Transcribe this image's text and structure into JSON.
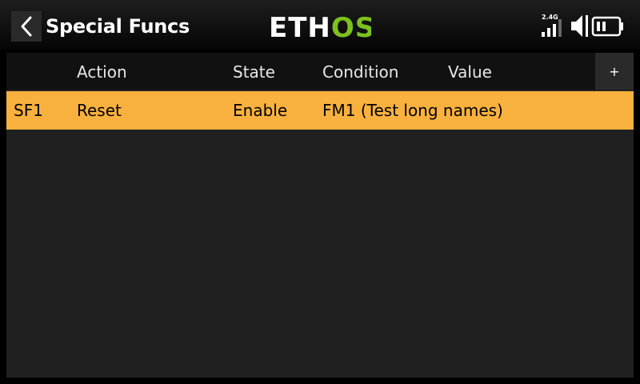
{
  "header": {
    "title": "Special Funcs",
    "logo_text": "ETHOS",
    "status": {
      "radio_band_label": "2.4G",
      "signal_level": 0.75,
      "icons": [
        "signal-bars-icon",
        "speaker-icon",
        "battery-icon"
      ]
    }
  },
  "table": {
    "columns": [
      "Action",
      "State",
      "Condition",
      "Value"
    ],
    "add_label": "+",
    "rows": [
      {
        "id": "SF1",
        "action": "Reset",
        "state": "Enable",
        "condition": "FM1 (Test long names)",
        "value": ""
      }
    ]
  },
  "colors": {
    "selected_row": "#f8b13e",
    "panel": "#202020",
    "logo_green": "#7cc11f"
  }
}
